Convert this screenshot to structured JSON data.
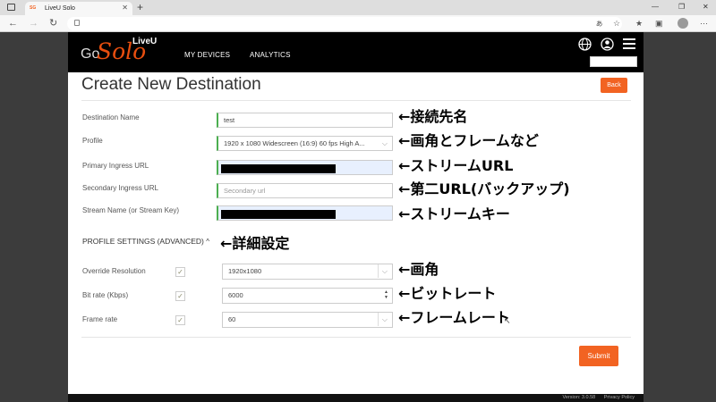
{
  "browser": {
    "tab_title": "LiveU Solo",
    "tab_favicon": "SG",
    "tab_close": "✕",
    "new_tab": "+",
    "win_minimize": "—",
    "win_maximize": "❐",
    "win_close": "✕",
    "nav_back": "←",
    "nav_forward": "→",
    "nav_reload": "↻"
  },
  "header": {
    "logo_go": "Go",
    "logo_solo": "Solo",
    "logo_liveu": "LiveU",
    "nav": [
      "MY DEVICES",
      "ANALYTICS"
    ]
  },
  "page": {
    "title": "Create New Destination",
    "back_label": "Back",
    "submit_label": "Submit"
  },
  "fields": {
    "destination_name": {
      "label": "Destination Name",
      "value": "test"
    },
    "profile": {
      "label": "Profile",
      "value": "1920 x 1080 Widescreen (16:9) 60 fps High A..."
    },
    "primary_ingress": {
      "label": "Primary Ingress URL",
      "value": ""
    },
    "secondary_ingress": {
      "label": "Secondary Ingress URL",
      "placeholder": "Secondary url"
    },
    "stream_name": {
      "label": "Stream Name (or Stream Key)",
      "value": ""
    }
  },
  "advanced": {
    "section_label": "PROFILE SETTINGS (ADVANCED)",
    "caret": "^",
    "override_resolution": {
      "label": "Override Resolution",
      "checked": true,
      "value": "1920x1080"
    },
    "bit_rate": {
      "label": "Bit rate (Kbps)",
      "checked": true,
      "value": "6000"
    },
    "frame_rate": {
      "label": "Frame rate",
      "checked": true,
      "value": "60"
    }
  },
  "footer": {
    "version": "Version: 3.0.58",
    "privacy": "Privacy Policy"
  },
  "annotations": {
    "destination_name": "←接続先名",
    "profile": "←画角とフレームなど",
    "primary_ingress": "←ストリームURL",
    "secondary_ingress": "←第二URL(バックアップ)",
    "stream_name": "←ストリームキー",
    "advanced": "←詳細設定",
    "override_resolution": "←画角",
    "bit_rate": "←ビットレート",
    "frame_rate": "←フレームレート"
  },
  "colors": {
    "accent": "#f26322",
    "header_bg": "#000000",
    "valid_border": "#4caf50",
    "autofill_bg": "#e8f0fe"
  }
}
